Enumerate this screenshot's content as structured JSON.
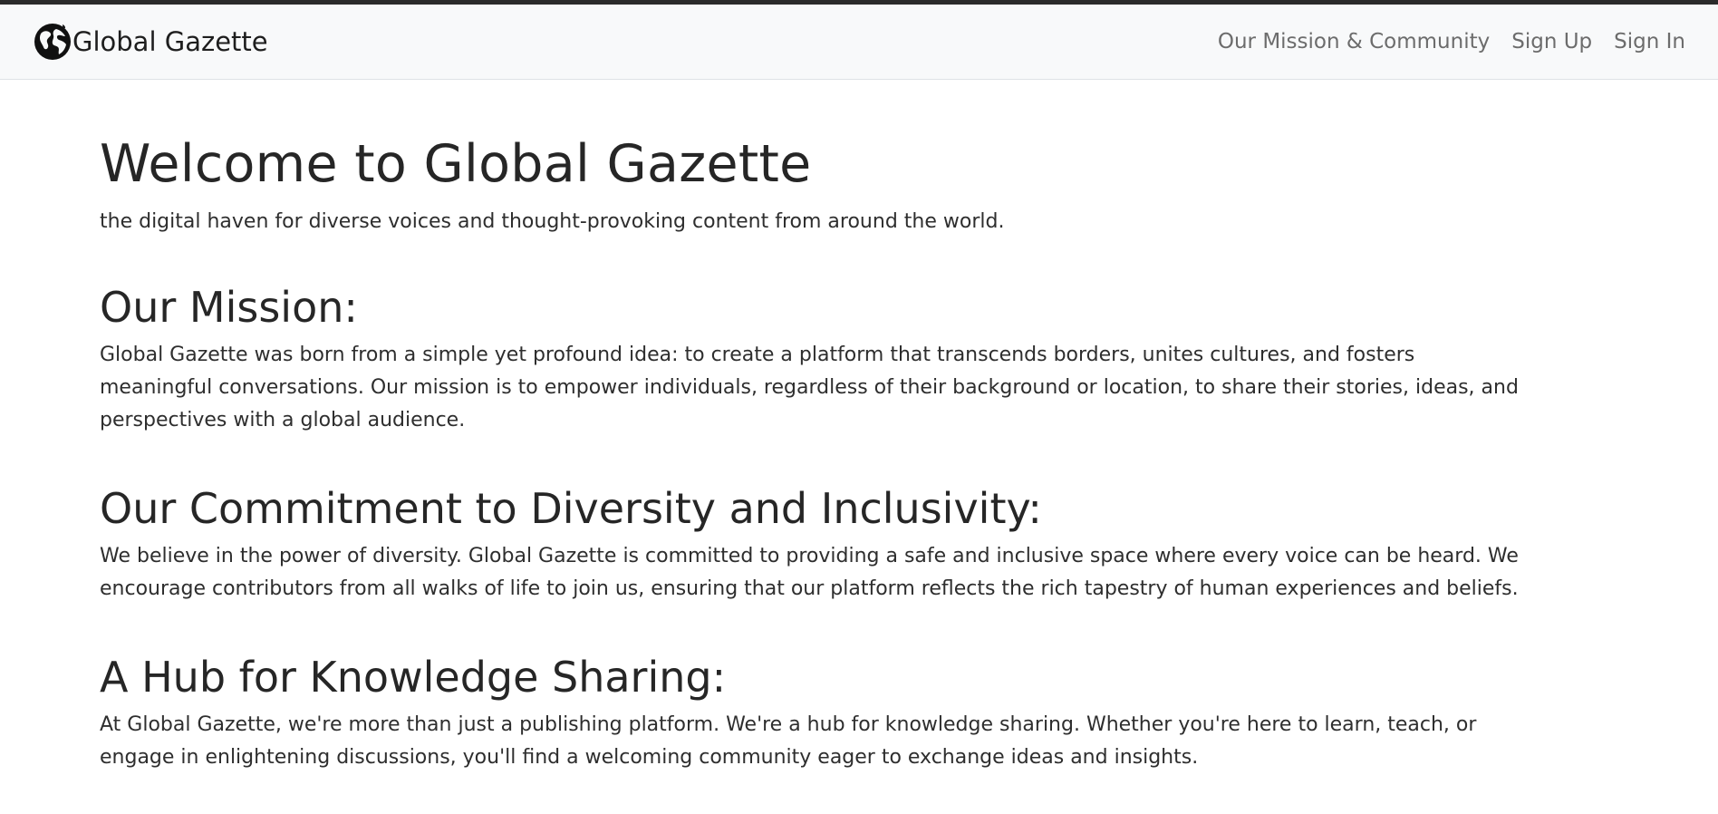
{
  "navbar": {
    "brand": "Global Gazette",
    "links": [
      "Our Mission & Community",
      "Sign Up",
      "Sign In"
    ]
  },
  "hero": {
    "title": "Welcome to Global Gazette",
    "tagline": "the digital haven for diverse voices and thought-provoking content from around the world."
  },
  "sections": [
    {
      "heading": "Our Mission:",
      "text": "Global Gazette was born from a simple yet profound idea: to create a platform that transcends borders, unites cultures, and fosters meaningful conversations. Our mission is to empower individuals, regardless of their background or location, to share their stories, ideas, and perspectives with a global audience."
    },
    {
      "heading": "Our Commitment to Diversity and Inclusivity:",
      "text": "We believe in the power of diversity. Global Gazette is committed to providing a safe and inclusive space where every voice can be heard. We encourage contributors from all walks of life to join us, ensuring that our platform reflects the rich tapestry of human experiences and beliefs."
    },
    {
      "heading": "A Hub for Knowledge Sharing:",
      "text": "At Global Gazette, we're more than just a publishing platform. We're a hub for knowledge sharing. Whether you're here to learn, teach, or engage in enlightening discussions, you'll find a welcoming community eager to exchange ideas and insights."
    }
  ],
  "icons": {
    "brand": "globe-icon"
  }
}
